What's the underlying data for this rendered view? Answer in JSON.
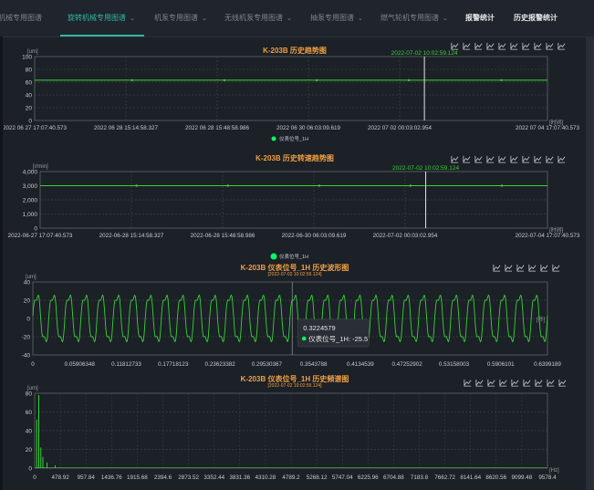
{
  "nav": {
    "tabs": [
      {
        "label": "机械专用图谱",
        "active": false
      },
      {
        "label": "旋转机械专用图谱",
        "active": true
      },
      {
        "label": "机泵专用图谱",
        "active": false
      },
      {
        "label": "无线机泵专用图谱",
        "active": false
      },
      {
        "label": "抽泵专用图谱",
        "active": false
      },
      {
        "label": "燃气轮机专用图谱",
        "active": false
      },
      {
        "label": "报警统计",
        "active": false
      },
      {
        "label": "历史报警统计",
        "active": false
      }
    ]
  },
  "colors": {
    "accent": "#2fb7a0",
    "title": "#f0a041",
    "series": "#35d435",
    "marker": "#00ff66",
    "bg": "#1c2027"
  },
  "chart_data": [
    {
      "type": "line",
      "title": "K-203B 历史趋势图",
      "ylabel": "[um]",
      "xlabel": "[时间]",
      "ylim": [
        0,
        100
      ],
      "yticks": [
        "100",
        "80",
        "60",
        "40",
        "20",
        "0"
      ],
      "xticks": [
        "2022 06 27 17:07:40.573",
        "2022 06 28 15:14:58.327",
        "2022 06 28 15:48:58.986",
        "2022 06 30 06:03:09.619",
        "2022 07 02 00:03:02.954",
        "2022 07 04 17:07:40.573"
      ],
      "cursor_label": "2022-07-02 10:02:59.124",
      "series": [
        {
          "name": "仪表位号_1H",
          "value": 63
        }
      ]
    },
    {
      "type": "line",
      "title": "K-203B 历史转速趋势图",
      "ylabel": "[r/min]",
      "xlabel": "[时间]",
      "ylim": [
        0,
        4000
      ],
      "yticks": [
        "4,000",
        "3,000",
        "2,000",
        "1,000",
        "0"
      ],
      "xticks": [
        "2022-06-27 17:07:40.573",
        "2022-06-28 15:14:58.327",
        "2022-06-28 15:48:58.986",
        "2022-06-30 06:03:09.619",
        "2022-07-02 00:03:02.954",
        "2022-07-04 17:07:40.573"
      ],
      "cursor_label": "2022-07-02 10:02:59.124",
      "series": [
        {
          "name": "仪表位号_1H",
          "value": 3000
        }
      ]
    },
    {
      "type": "line",
      "title": "K-203B 仪表位号_1H  历史波形图",
      "subtitle": "[2022-07-02 10:02:59.124]",
      "ylabel": "[um]",
      "xlabel": "[秒]",
      "ylim": [
        -40,
        40
      ],
      "xlim": [
        0,
        0.6399189
      ],
      "yticks": [
        "40",
        "20",
        "0",
        "-20",
        "-40"
      ],
      "xticks": [
        "0",
        "0.05906348",
        "0.11812733",
        "0.17718123",
        "0.23623382",
        "0.29530367",
        "0.3543788",
        "0.4134539",
        "0.47252902",
        "0.53158003",
        "0.5906101",
        "0.6399189"
      ],
      "series": [
        {
          "name": "仪表位号_1H",
          "amplitude": 32,
          "cycles": 32
        }
      ],
      "tooltip": {
        "x": "0.3224579",
        "label": "仪表位号_1H: -25.5"
      }
    },
    {
      "type": "bar",
      "title": "K-203B 仪表位号_1H  历史频谱图",
      "subtitle": "[2022-07-02 10:02:59.124]",
      "ylabel": "[um]",
      "xlabel": "[Hz]",
      "ylim": [
        0,
        80
      ],
      "xlim": [
        0,
        10000
      ],
      "yticks": [
        "80",
        "60",
        "40",
        "20",
        "0"
      ],
      "xticks": [
        "0",
        "478.92",
        "957.84",
        "1436.76",
        "1915.68",
        "2394.6",
        "2873.52",
        "3352.44",
        "3831.36",
        "4310.28",
        "4789.2",
        "5268.12",
        "5747.04",
        "6225.96",
        "6704.88",
        "7183.8",
        "7662.72",
        "8141.64",
        "8620.56",
        "9099.48",
        "9578.4"
      ],
      "peaks": [
        {
          "x": 40,
          "y": 52
        },
        {
          "x": 80,
          "y": 78
        },
        {
          "x": 120,
          "y": 22
        },
        {
          "x": 160,
          "y": 12
        },
        {
          "x": 240,
          "y": 6
        },
        {
          "x": 400,
          "y": 3
        }
      ]
    }
  ]
}
